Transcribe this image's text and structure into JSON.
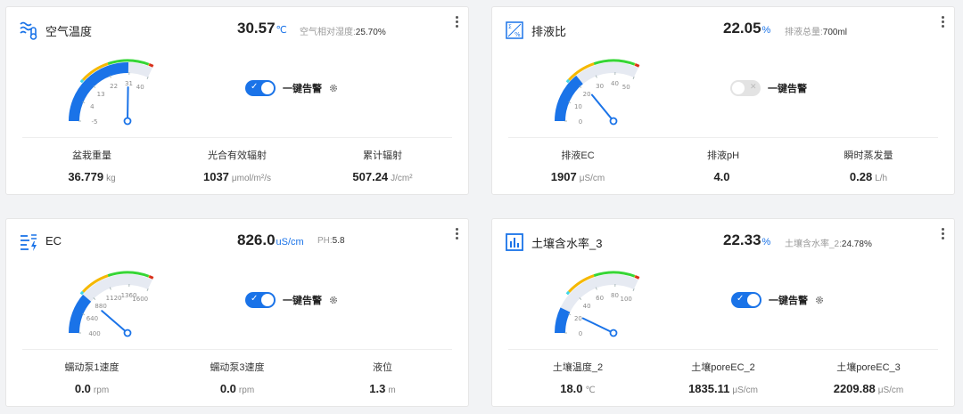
{
  "cards": [
    {
      "title": "空气温度",
      "icon": "temperature-waves-icon",
      "main_value": "30.57",
      "main_unit": "℃",
      "sub_label": "空气相对湿度:",
      "sub_value": "25.70",
      "sub_unit": "%",
      "gauge": {
        "ticks": [
          "-5",
          "4",
          "13",
          "22",
          "31",
          "40"
        ],
        "min": -5,
        "max": 40,
        "value": 30.57
      },
      "alarm": {
        "label": "一键告警",
        "enabled": true
      },
      "stats": [
        {
          "label": "盆栽重量",
          "value": "36.779",
          "unit": "kg"
        },
        {
          "label": "光合有效辐射",
          "value": "1037",
          "unit": "μmol/m²/s"
        },
        {
          "label": "累计辐射",
          "value": "507.24",
          "unit": "J/cm²"
        }
      ]
    },
    {
      "title": "排液比",
      "icon": "ratio-percent-icon",
      "main_value": "22.05",
      "main_unit": "%",
      "sub_label": "排液总量:",
      "sub_value": "700",
      "sub_unit": "ml",
      "gauge": {
        "ticks": [
          "0",
          "10",
          "20",
          "30",
          "40",
          "50"
        ],
        "min": 0,
        "max": 50,
        "value": 22.05
      },
      "alarm": {
        "label": "一键告警",
        "enabled": false
      },
      "stats": [
        {
          "label": "排液EC",
          "value": "1907",
          "unit": "μS/cm"
        },
        {
          "label": "排液pH",
          "value": "4.0",
          "unit": ""
        },
        {
          "label": "瞬时蒸发量",
          "value": "0.28",
          "unit": "L/h"
        }
      ]
    },
    {
      "title": "EC",
      "icon": "ec-sensor-icon",
      "main_value": "826.0",
      "main_unit": "uS/cm",
      "sub_label": "PH:",
      "sub_value": "5.8",
      "sub_unit": "",
      "gauge": {
        "ticks": [
          "400",
          "640",
          "880",
          "1120",
          "1360",
          "1600"
        ],
        "min": 400,
        "max": 1600,
        "value": 826.0
      },
      "alarm": {
        "label": "一键告警",
        "enabled": true
      },
      "stats": [
        {
          "label": "蠕动泵1速度",
          "value": "0.0",
          "unit": "rpm"
        },
        {
          "label": "蠕动泵3速度",
          "value": "0.0",
          "unit": "rpm"
        },
        {
          "label": "液位",
          "value": "1.3",
          "unit": "m"
        }
      ]
    },
    {
      "title": "土壤含水率_3",
      "icon": "bar-chart-icon",
      "main_value": "22.33",
      "main_unit": "%",
      "sub_label": "土壤含水率_2:",
      "sub_value": "24.78",
      "sub_unit": "%",
      "gauge": {
        "ticks": [
          "0",
          "20",
          "40",
          "60",
          "80",
          "100"
        ],
        "min": 0,
        "max": 100,
        "value": 22.33
      },
      "alarm": {
        "label": "一键告警",
        "enabled": true
      },
      "stats": [
        {
          "label": "土壤温度_2",
          "value": "18.0",
          "unit": "℃"
        },
        {
          "label": "土壤poreEC_2",
          "value": "1835.11",
          "unit": "μS/cm"
        },
        {
          "label": "土壤poreEC_3",
          "value": "2209.88",
          "unit": "μS/cm"
        }
      ]
    }
  ],
  "colors": {
    "accent": "#1a73e8",
    "track": "#e6eaf2",
    "zone_cyan": "#40d8e8",
    "zone_yellow": "#f5b800",
    "zone_green": "#36d636",
    "zone_red": "#d8301a"
  }
}
